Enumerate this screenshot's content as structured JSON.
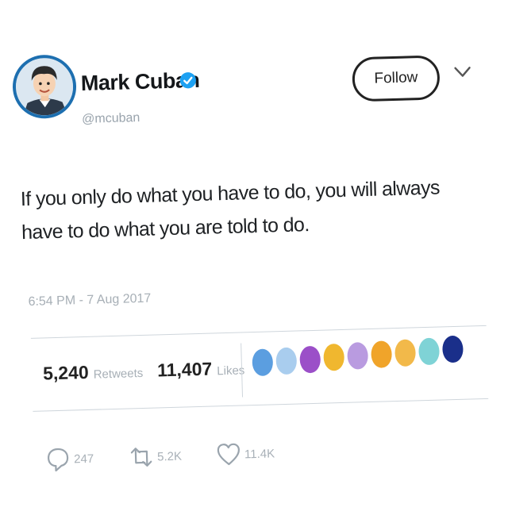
{
  "author": {
    "name": "Mark Cuban",
    "handle": "@mcuban",
    "verified_color": "#1da1f2",
    "avatar_ring_color": "#1d6fb0"
  },
  "follow_button": {
    "label": "Follow"
  },
  "menu_icon": "chevron-down-icon",
  "tweet": {
    "text": "If you only do what you have to do, you will always have to do what you are told to do.",
    "timestamp": "6:54 PM - 7 Aug 2017"
  },
  "stats": {
    "retweets": {
      "count": "5,240",
      "label": "Retweets"
    },
    "likes": {
      "count": "11,407",
      "label": "Likes"
    }
  },
  "liker_avatar_colors": [
    "#5b9ee0",
    "#a9cdee",
    "#9b4fc8",
    "#f0b72f",
    "#b99be0",
    "#f0a42a",
    "#f2b94a",
    "#7fd3d6",
    "#1a2f8a"
  ],
  "actions": {
    "replies": "247",
    "retweets": "5.2K",
    "likes": "11.4K"
  }
}
